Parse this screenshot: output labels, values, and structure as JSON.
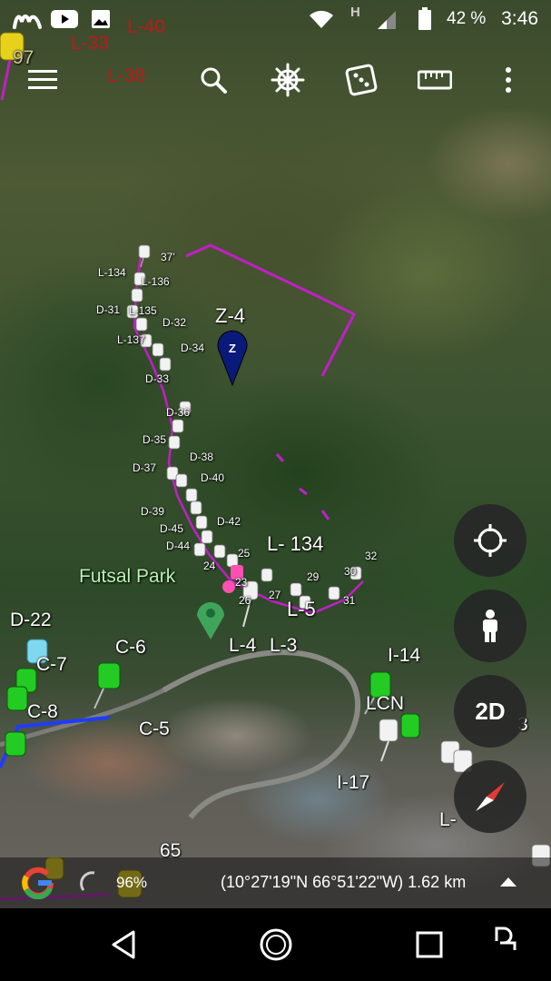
{
  "status_bar": {
    "carrier_logo": "movistar-m-logo",
    "notification_icons": [
      "youtube-icon",
      "gallery-icon"
    ],
    "wifi_icon": "wifi-icon",
    "network_type": "H",
    "signal_icon": "signal-icon",
    "battery_percent": "42 %",
    "time": "3:46"
  },
  "toolbar": {
    "menu_icon": "menu-icon",
    "search_icon": "search-icon",
    "steering_icon": "ship-wheel-icon",
    "random_icon": "dice-icon",
    "measure_icon": "ruler-icon",
    "more_icon": "more-vert-icon"
  },
  "map_labels": {
    "red_topleft_1": "L-33",
    "red_topleft_2": "L-40",
    "red_topleft_3": "L-38",
    "topleft_97": "97",
    "z4": "Z-4",
    "z4_pin_letter": "Z",
    "p37": "37'",
    "l134_small": "L-134",
    "l136": "L-136",
    "d31": "D-31",
    "l135": "L-135",
    "d32": "D-32",
    "l137": "L-137",
    "d34": "D-34",
    "d33": "D-33",
    "d36": "D-36",
    "d35": "D-35",
    "d38": "D-38",
    "d37": "D-37",
    "d40": "D-40",
    "d39": "D-39",
    "d42": "D-42",
    "d45": "D-45",
    "d44": "D-44",
    "n25": "25",
    "n24": "24",
    "n23": "23",
    "n26": "26",
    "n27": "27",
    "n29": "29",
    "n30": "30",
    "n31": "31",
    "n32": "32",
    "l134_large": "L- 134",
    "l5": "L-5",
    "l4": "L-4",
    "l3": "L-3",
    "futsal": "Futsal Park",
    "d22": "D-22",
    "c7": "C-7",
    "c6": "C-6",
    "c8": "C-8",
    "c5": "C-5",
    "i14": "I-14",
    "lcn": "LCN",
    "i17": "I-17",
    "l_partial": "L-",
    "n65": "65",
    "n3": "3"
  },
  "right_buttons": {
    "locate_icon": "crosshair-icon",
    "streetview_icon": "pegman-icon",
    "view_mode_label": "2D",
    "compass_icon": "compass-icon"
  },
  "info_bar": {
    "logo": "google-g-logo",
    "load_percent": "96%",
    "coordinates": "(10°27'19\"N 66°51'22\"W) 1.62 km",
    "expand_icon": "caret-up-icon"
  },
  "nav_bar": {
    "back_icon": "back-triangle-icon",
    "home_icon": "home-circle-icon",
    "recents_icon": "recents-square-icon",
    "extra_icon": "screen-rotate-icon"
  },
  "colors": {
    "boundary_magenta": "#c21ec8",
    "red_label": "#c01818",
    "park_label": "#b9f5b1",
    "pin_green": "#22cc22",
    "pin_white": "#f2f2f2",
    "pin_blue": "#0a1a7a",
    "fab_bg": "#262626"
  }
}
